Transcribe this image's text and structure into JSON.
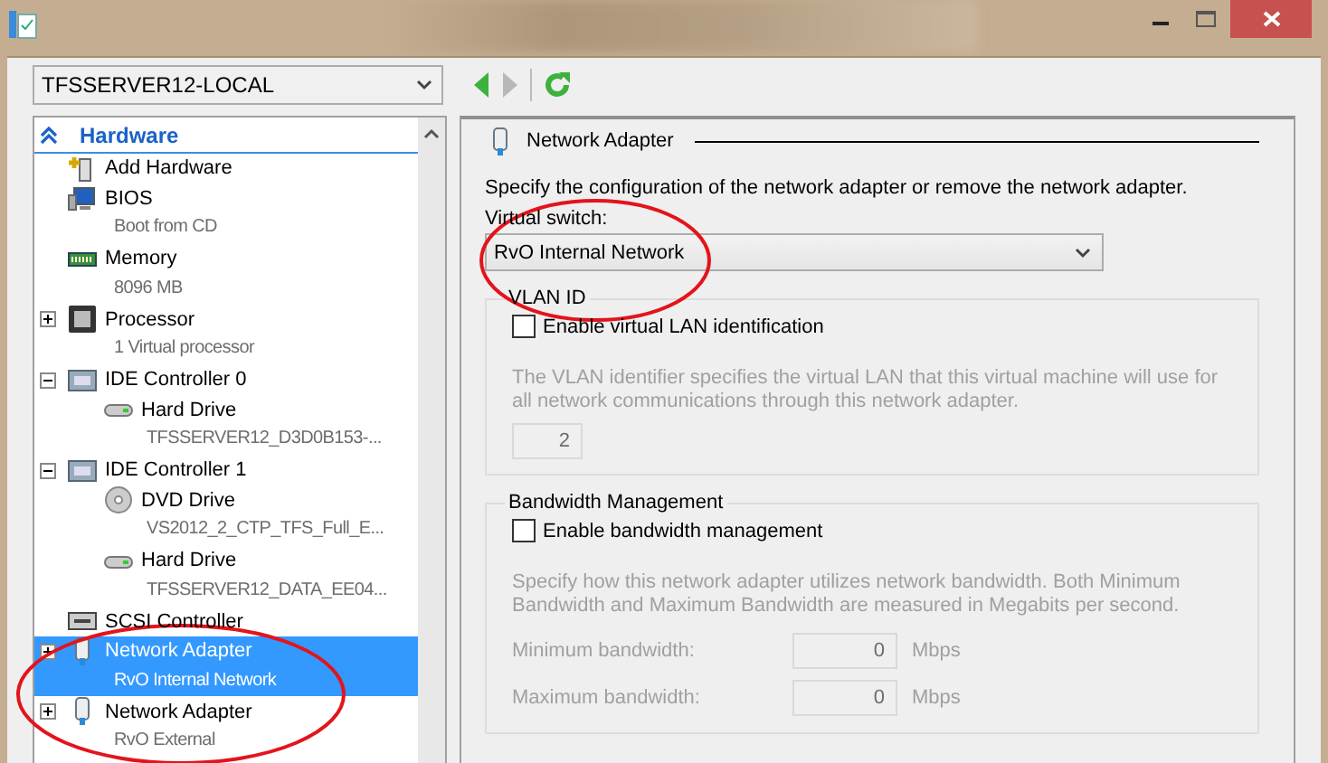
{
  "machine_selector": {
    "value": "TFSSERVER12-LOCAL"
  },
  "navigation": [
    {
      "kind": "back",
      "disabled": false
    },
    {
      "kind": "forward",
      "disabled": true
    },
    {
      "kind": "refresh",
      "disabled": false
    }
  ],
  "hardware_tree": {
    "header": "Hardware",
    "items": [
      {
        "kind": "add-hardware",
        "label": "Add Hardware",
        "selected": false
      },
      {
        "kind": "bios",
        "label": "BIOS",
        "detail": "Boot from CD",
        "selected": false
      },
      {
        "kind": "memory",
        "label": "Memory",
        "detail": "8096 MB",
        "selected": false
      },
      {
        "kind": "processor",
        "label": "Processor",
        "detail": "1 Virtual processor",
        "expanded": false,
        "selected": false
      },
      {
        "kind": "controller",
        "label": "IDE Controller 0",
        "expanded": true,
        "selected": false,
        "children": [
          {
            "kind": "hard-drive",
            "label": "Hard Drive",
            "detail": "TFSSERVER12_D3D0B153-...",
            "selected": false
          }
        ]
      },
      {
        "kind": "controller",
        "label": "IDE Controller 1",
        "expanded": true,
        "selected": false,
        "children": [
          {
            "kind": "dvd-drive",
            "label": "DVD Drive",
            "detail": "VS2012_2_CTP_TFS_Full_E...",
            "selected": false
          },
          {
            "kind": "hard-drive",
            "label": "Hard Drive",
            "detail": "TFSSERVER12_DATA_EE04...",
            "selected": false
          }
        ]
      },
      {
        "kind": "scsi",
        "label": "SCSI Controller",
        "selected": false
      },
      {
        "kind": "network-adapter",
        "label": "Network Adapter",
        "detail": "RvO Internal Network",
        "expanded": false,
        "selected": true
      },
      {
        "kind": "network-adapter",
        "label": "Network Adapter",
        "detail": "RvO External",
        "expanded": false,
        "selected": false
      }
    ]
  },
  "settings": {
    "title": "Network Adapter",
    "description": "Specify the configuration of the network adapter or remove the network adapter.",
    "virtual_switch": {
      "label": "Virtual switch:",
      "value": "RvO Internal Network"
    },
    "vlan": {
      "legend": "VLAN ID",
      "checkbox": {
        "label": "Enable virtual LAN identification",
        "checked": false
      },
      "note": "The VLAN identifier specifies the virtual LAN that this virtual machine will use for all network communications through this network adapter.",
      "id_field": {
        "value": "2",
        "disabled": true
      }
    },
    "bandwidth": {
      "legend": "Bandwidth Management",
      "checkbox": {
        "label": "Enable bandwidth management",
        "checked": false
      },
      "note": "Specify how this network adapter utilizes network bandwidth. Both Minimum Bandwidth and Maximum Bandwidth are measured in Megabits per second.",
      "fields": [
        {
          "label": "Minimum bandwidth:",
          "value": "0",
          "unit": "Mbps",
          "disabled": true
        },
        {
          "label": "Maximum bandwidth:",
          "value": "0",
          "unit": "Mbps",
          "disabled": true
        }
      ]
    }
  }
}
